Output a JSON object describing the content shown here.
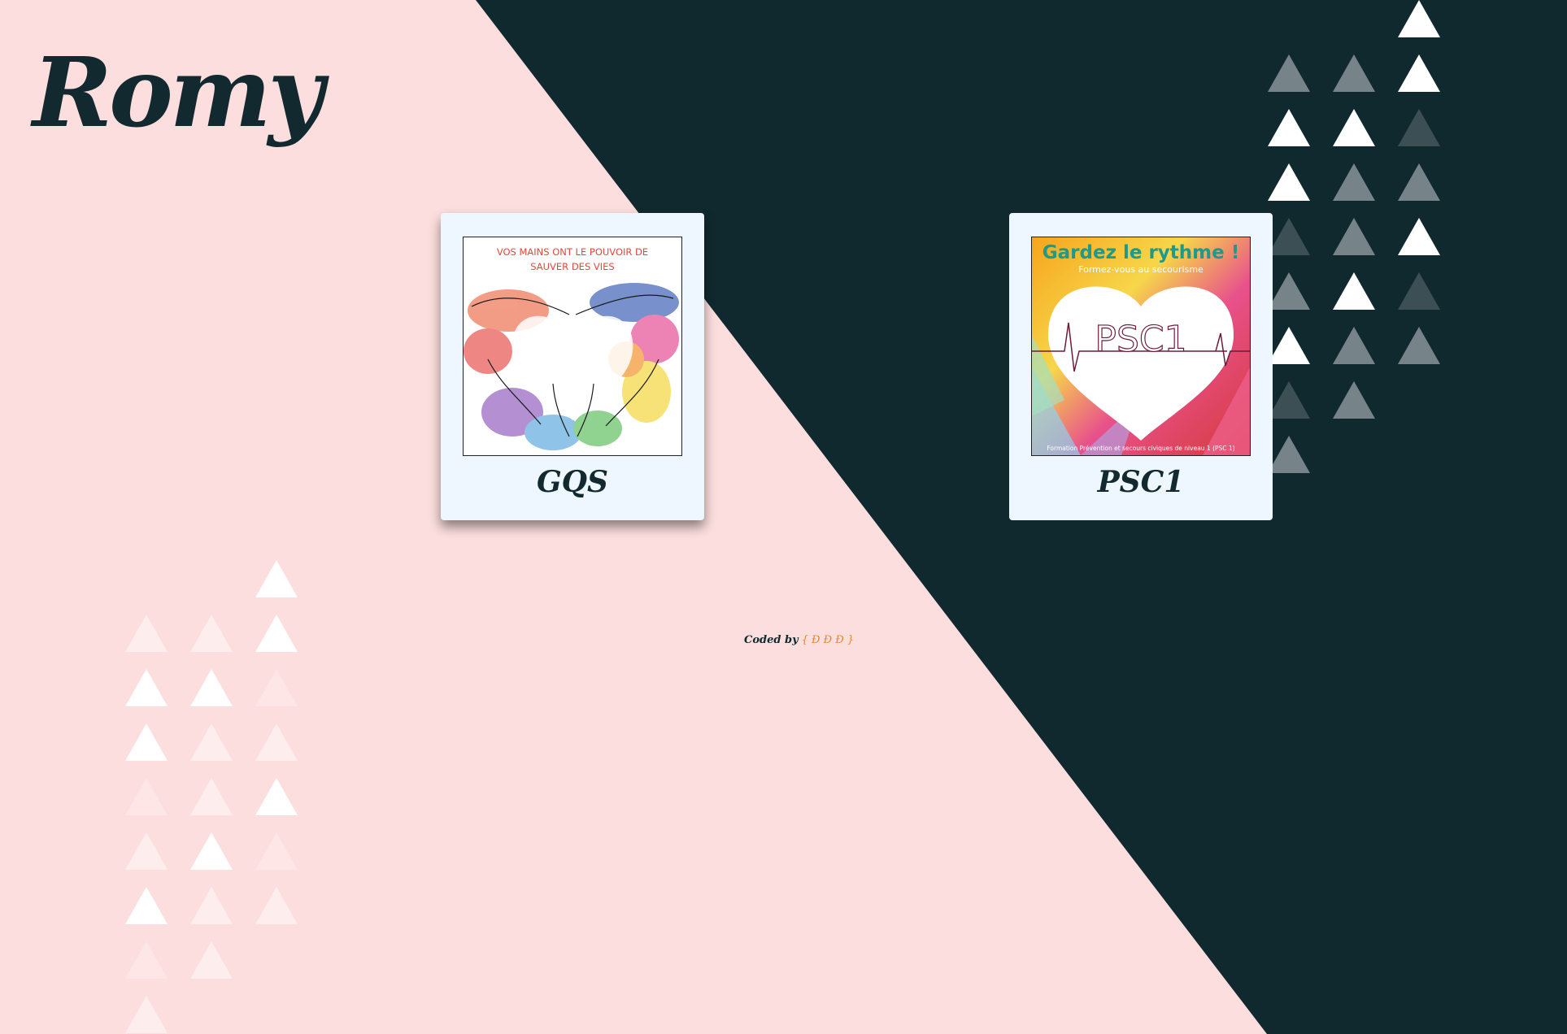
{
  "site": {
    "logo": "Romy"
  },
  "cards": [
    {
      "label": "GQS",
      "image_text": [
        "VOS MAINS ONT LE POUVOIR DE",
        "SAUVER DES VIES"
      ]
    },
    {
      "label": "PSC1",
      "image_title": "Gardez le rythme !",
      "image_subtitle": "Formez-vous au secourisme",
      "image_center": "PSC1",
      "image_footer": "Formation Prévention et secours civiques de niveau 1 (PSC 1)"
    }
  ],
  "footer": {
    "coded_by": "Coded by",
    "handle": "{ Ð Ð Ð }"
  },
  "colors": {
    "background_pink": "#fbdedd",
    "background_dark": "#10292f",
    "title_dark": "#11292f",
    "handle_orange": "#e8882c",
    "card_bg": "#eef7ff"
  },
  "icons": {
    "decoration": "triangle-icon"
  }
}
